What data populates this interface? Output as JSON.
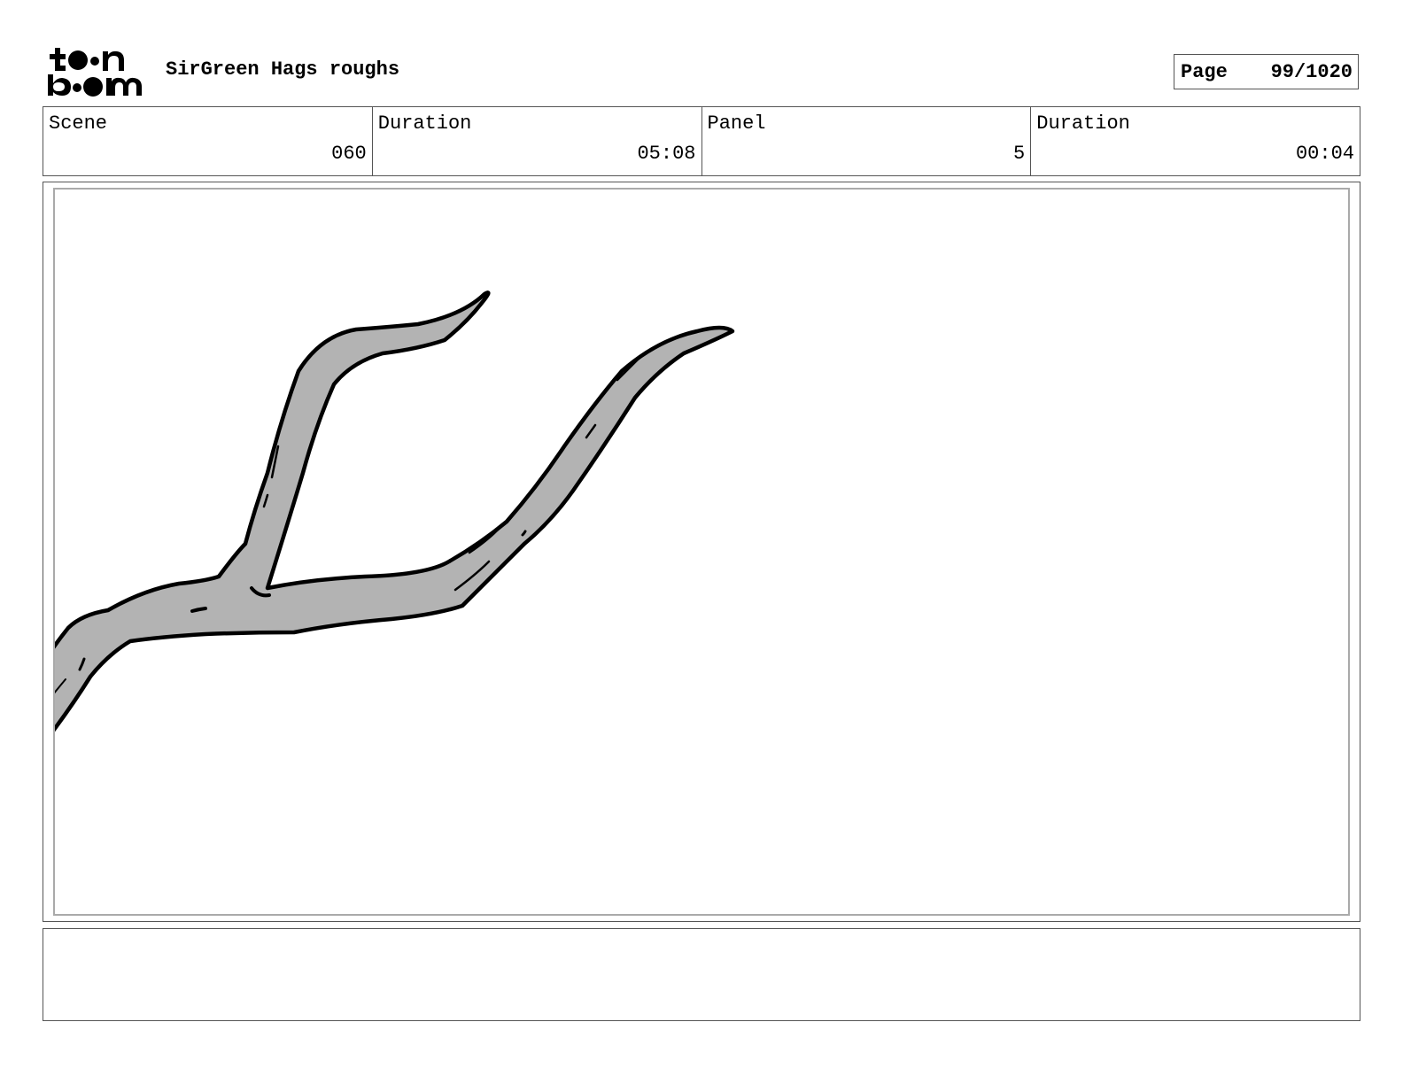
{
  "header": {
    "logo_text": "toon boom",
    "project_title": "SirGreen Hags roughs",
    "page_label": "Page",
    "page_value": "99/1020"
  },
  "info": {
    "scene_label": "Scene",
    "scene_value": "060",
    "scene_duration_label": "Duration",
    "scene_duration_value": "05:08",
    "panel_label": "Panel",
    "panel_value": "5",
    "panel_duration_label": "Duration",
    "panel_duration_value": "00:04"
  },
  "panel": {
    "drawing": "tree-branch-sketch",
    "branch_fill": "#b3b3b3",
    "outline_color": "#000000"
  },
  "notes": {
    "text": ""
  }
}
